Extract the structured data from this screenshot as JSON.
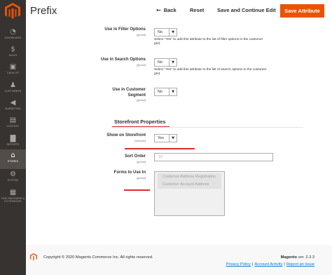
{
  "sidebar": {
    "logo_icon": "magento-logo-icon",
    "items": [
      {
        "label": "DASHBOARD",
        "icon": "dashboard-icon",
        "glyph": "◔",
        "active": false
      },
      {
        "label": "SALES",
        "icon": "dollar-icon",
        "glyph": "$",
        "active": false
      },
      {
        "label": "CATALOG",
        "icon": "box-icon",
        "glyph": "▣",
        "active": false
      },
      {
        "label": "CUSTOMERS",
        "icon": "person-icon",
        "glyph": "♟",
        "active": false
      },
      {
        "label": "MARKETING",
        "icon": "megaphone-icon",
        "glyph": "◀",
        "active": false
      },
      {
        "label": "CONTENT",
        "icon": "content-icon",
        "glyph": "▤",
        "active": false
      },
      {
        "label": "REPORTS",
        "icon": "bar-chart-icon",
        "glyph": "▇",
        "active": false
      },
      {
        "label": "STORES",
        "icon": "store-icon",
        "glyph": "⌂",
        "active": true
      },
      {
        "label": "SYSTEM",
        "icon": "gear-icon",
        "glyph": "⚙",
        "active": false
      },
      {
        "label": "FIND PARTNERS & EXTENSIONS",
        "icon": "blocks-icon",
        "glyph": "▦",
        "active": false
      }
    ]
  },
  "header": {
    "title": "Prefix",
    "back_label": "Back",
    "back_glyph": "←",
    "reset_label": "Reset",
    "save_continue_label": "Save and Continue Edit",
    "save_label": "Save Attribute"
  },
  "form": {
    "use_in_filter": {
      "label": "Use in Filter Options",
      "scope": "[global]",
      "value": "No",
      "note": "Select \"Yes\" to add this attribute to the list of filter options in the customer grid."
    },
    "use_in_search": {
      "label": "Use in Search Options",
      "scope": "[global]",
      "value": "No",
      "note": "Select \"Yes\" to add this attribute to the list of search options in the customer grid."
    },
    "use_in_segment": {
      "label": "Use in Customer Segment",
      "scope": "[global]",
      "value": "No"
    },
    "section_title": "Storefront Properties",
    "show_on_storefront": {
      "label": "Show on Storefront",
      "scope": "[website]",
      "value": "Yes"
    },
    "sort_order": {
      "label": "Sort Order",
      "scope": "[global]",
      "placeholder": "10"
    },
    "forms_to_use_in": {
      "label": "Forms to Use In",
      "scope": "[global]",
      "options": [
        "Customer Address Registration",
        "Customer Account Address"
      ]
    },
    "caret_glyph": "▼"
  },
  "footer": {
    "copyright": "Copyright © 2020 Magento Commerce Inc. All rights reserved.",
    "brand": "Magento",
    "version": "ver. 2.3.3",
    "links": [
      "Privacy Policy",
      "Account Activity",
      "Report an Issue"
    ],
    "separator": "|"
  },
  "colors": {
    "sidebar_bg": "#373330",
    "accent": "#eb5202",
    "annotation_red": "#e02b27",
    "link": "#007bdb"
  }
}
